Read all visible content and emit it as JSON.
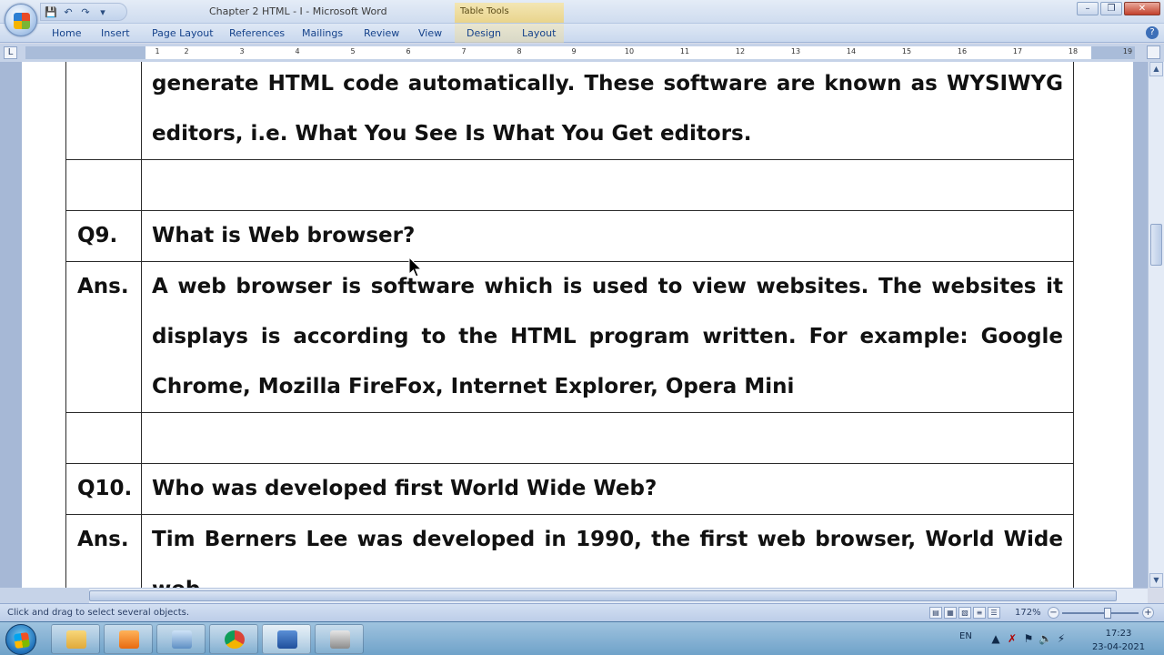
{
  "window": {
    "title": "Chapter 2 HTML - I - Microsoft Word",
    "contextual_tab_group": "Table Tools"
  },
  "quick_access": {
    "save_icon": "save-icon",
    "undo_icon": "undo-icon",
    "redo_icon": "redo-icon",
    "customize_icon": "dropdown-icon"
  },
  "ribbon": {
    "tabs": [
      {
        "label": "Home"
      },
      {
        "label": "Insert"
      },
      {
        "label": "Page Layout"
      },
      {
        "label": "References"
      },
      {
        "label": "Mailings"
      },
      {
        "label": "Review"
      },
      {
        "label": "View"
      },
      {
        "label": "Design"
      },
      {
        "label": "Layout"
      }
    ]
  },
  "ruler": {
    "corner": "L",
    "ticks": [
      "1",
      "2",
      "3",
      "4",
      "5",
      "6",
      "7",
      "8",
      "9",
      "10",
      "11",
      "12",
      "13",
      "14",
      "15",
      "16",
      "17",
      "18",
      "19"
    ]
  },
  "document": {
    "rows": [
      {
        "label": "",
        "text": "generate HTML code automatically. These software are known as WYSIWYG editors, i.e. What You See Is What You Get editors.",
        "kind": "ans"
      },
      {
        "label": "",
        "text": "",
        "kind": "empty"
      },
      {
        "label": "Q9.",
        "text": "What is Web browser?",
        "kind": "q"
      },
      {
        "label": "Ans.",
        "text": "A web browser is software which is used to view websites. The websites it displays is according to the HTML program written. For example: Google Chrome, Mozilla FireFox, Internet Explorer, Opera Mini",
        "kind": "ans"
      },
      {
        "label": "",
        "text": "",
        "kind": "empty"
      },
      {
        "label": "Q10.",
        "text": "Who was developed first World Wide Web?",
        "kind": "q"
      },
      {
        "label": "Ans.",
        "text": "Tim Berners Lee was developed in 1990, the first web browser, World Wide web",
        "kind": "ans"
      }
    ]
  },
  "statusbar": {
    "message": "Click and drag to select several objects.",
    "zoom": "172%",
    "zoom_minus": "−",
    "zoom_plus": "+"
  },
  "taskbar": {
    "items": [
      {
        "icon": "file-explorer-icon"
      },
      {
        "icon": "media-player-icon"
      },
      {
        "icon": "computer-icon"
      },
      {
        "icon": "chrome-icon"
      },
      {
        "icon": "word-icon"
      },
      {
        "icon": "camera-icon"
      }
    ],
    "language": "EN",
    "time": "17:23",
    "date": "23-04-2021"
  },
  "colors": {
    "ribbon_blue": "#c9d8ee",
    "document_background": "#a6b8d6",
    "table_tools": "#e9d48c",
    "taskbar": "#6fa2c9"
  }
}
